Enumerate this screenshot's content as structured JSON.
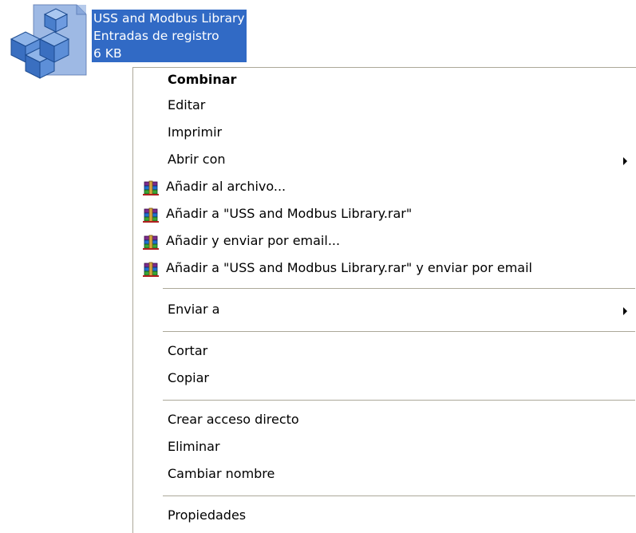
{
  "file": {
    "name": "USS and Modbus Library",
    "type": "Entradas de registro",
    "size": "6 KB"
  },
  "menu": {
    "items": [
      {
        "label": "Combinar",
        "bold": true
      },
      {
        "label": "Editar"
      },
      {
        "label": "Imprimir"
      },
      {
        "label": "Abrir con",
        "submenu": true
      },
      {
        "label": "Añadir al archivo...",
        "icon": "winrar-icon"
      },
      {
        "label": "Añadir a \"USS and Modbus Library.rar\"",
        "icon": "winrar-icon"
      },
      {
        "label": "Añadir y enviar por email...",
        "icon": "winrar-icon"
      },
      {
        "label": "Añadir a \"USS and Modbus Library.rar\" y enviar por email",
        "icon": "winrar-icon"
      },
      {
        "label": "Enviar a",
        "submenu": true
      },
      {
        "label": "Cortar"
      },
      {
        "label": "Copiar"
      },
      {
        "label": "Crear acceso directo"
      },
      {
        "label": "Eliminar"
      },
      {
        "label": "Cambiar nombre"
      },
      {
        "label": "Propiedades"
      }
    ]
  },
  "colors": {
    "selection": "#316ac5",
    "menu_border": "#aca899",
    "menu_background": "#ffffff"
  }
}
